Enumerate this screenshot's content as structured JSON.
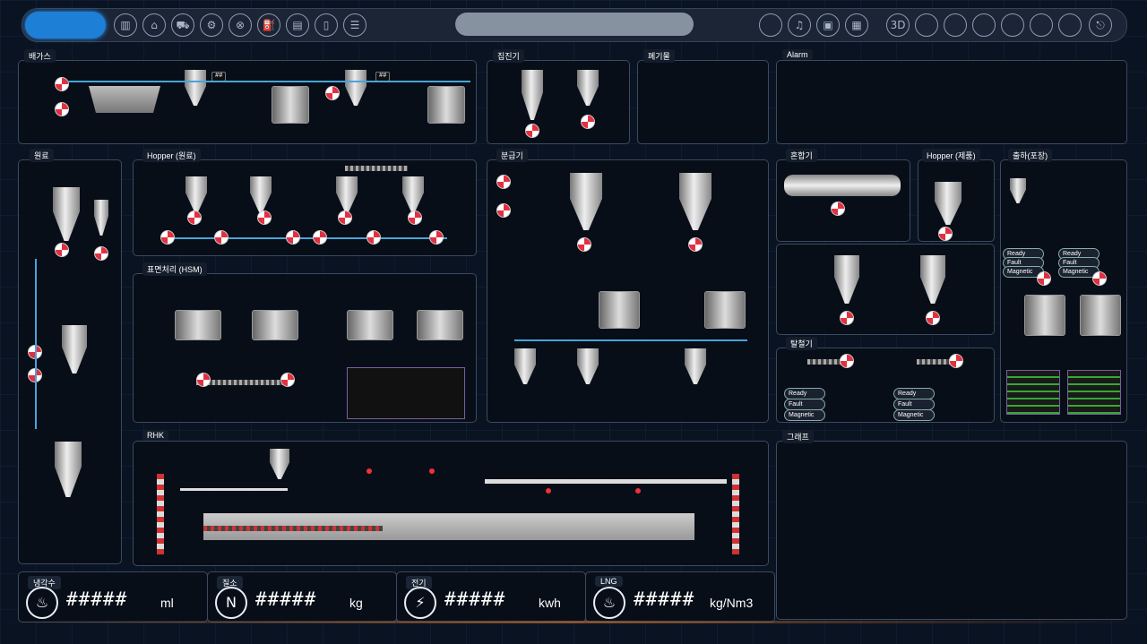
{
  "nav": {
    "icons": [
      "panel-icon",
      "process-a-icon",
      "vehicle-icon",
      "factory-icon",
      "filter-icon",
      "tank-truck-icon",
      "bus-icon",
      "tube-icon",
      "list-icon"
    ],
    "right_icons": [
      "circle-1-icon",
      "bell-icon",
      "monitor-icon",
      "chart-bars-icon"
    ],
    "icon_3d_label": "3D",
    "right_blank_count": 6,
    "exit_icon": "exit-icon"
  },
  "panels": {
    "exhaust": "배가스",
    "dust": "집진기",
    "waste": "폐기물",
    "alarm": "Alarm",
    "raw": "원료",
    "hopper_raw": "Hopper (원료)",
    "surface": "표면처리 (HSM)",
    "classifier": "분급기",
    "mixer": "혼합기",
    "hopper_prod": "Hopper (제품)",
    "shipping": "출하(포장)",
    "dehydrator": "탈철기",
    "graph": "그래프",
    "rhk": "RHK"
  },
  "placeholder_value": "##",
  "status": {
    "ready": "Ready",
    "fault": "Fault",
    "magnetic": "Magnetic"
  },
  "meters": [
    {
      "label": "냉각수",
      "icon": "water-temp-icon",
      "value": "#####",
      "unit": "ml"
    },
    {
      "label": "질소",
      "icon": "nitrogen-icon",
      "value": "#####",
      "unit": "kg"
    },
    {
      "label": "전기",
      "icon": "electricity-icon",
      "value": "#####",
      "unit": "kwh"
    },
    {
      "label": "LNG",
      "icon": "flame-icon",
      "value": "#####",
      "unit": "kg/Nm3"
    }
  ],
  "colors": {
    "accent": "#1e7fd6",
    "pipe": "#4aa3d8",
    "valve_red": "#e23040",
    "panel_border": "#3a4a60"
  }
}
